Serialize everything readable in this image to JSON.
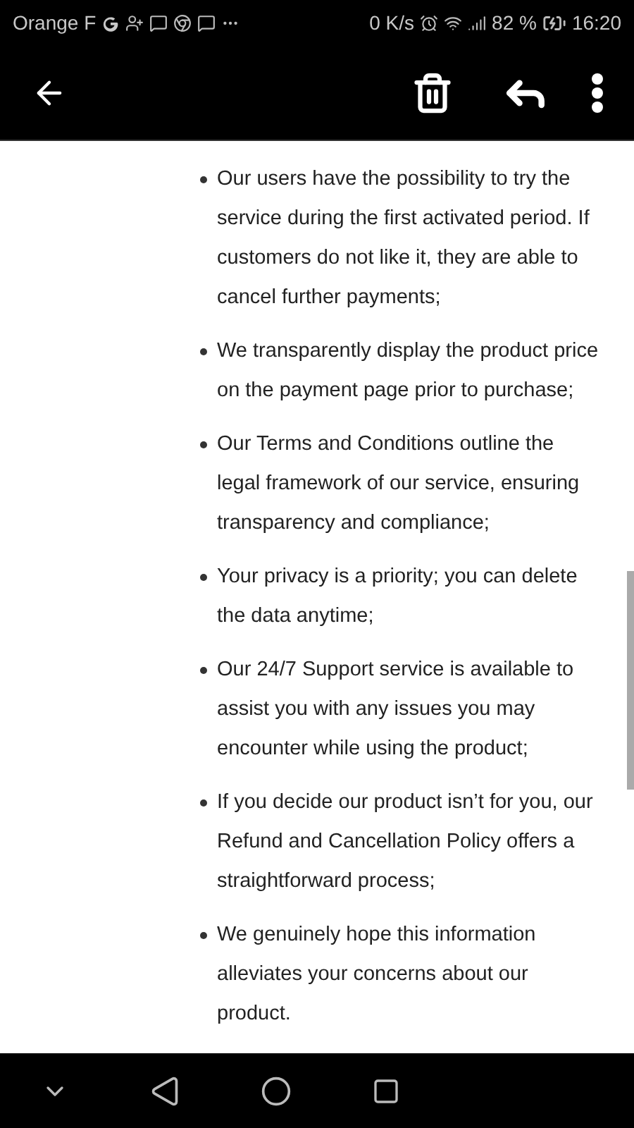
{
  "status_bar": {
    "carrier": "Orange F",
    "speed": "0 K/s",
    "battery": "82 %",
    "time": "16:20"
  },
  "items": [
    "Our users have the possibility to try the service during the first activated period. If customers do not like it, they are able to cancel further payments;",
    "We transparently display the product price on the payment page prior to purchase;",
    "Our Terms and Conditions outline the legal framework of our service, ensuring transparency and compliance;",
    "Your privacy is a priority; you can delete the data anytime;",
    "Our 24/7 Support service is available to assist you with any issues you may encounter while using the product;",
    "If you decide our product isn’t for you, our Refund and Cancellation Policy offers a straightforward process;",
    "We genuinely hope this information alleviates your concerns about our product."
  ]
}
